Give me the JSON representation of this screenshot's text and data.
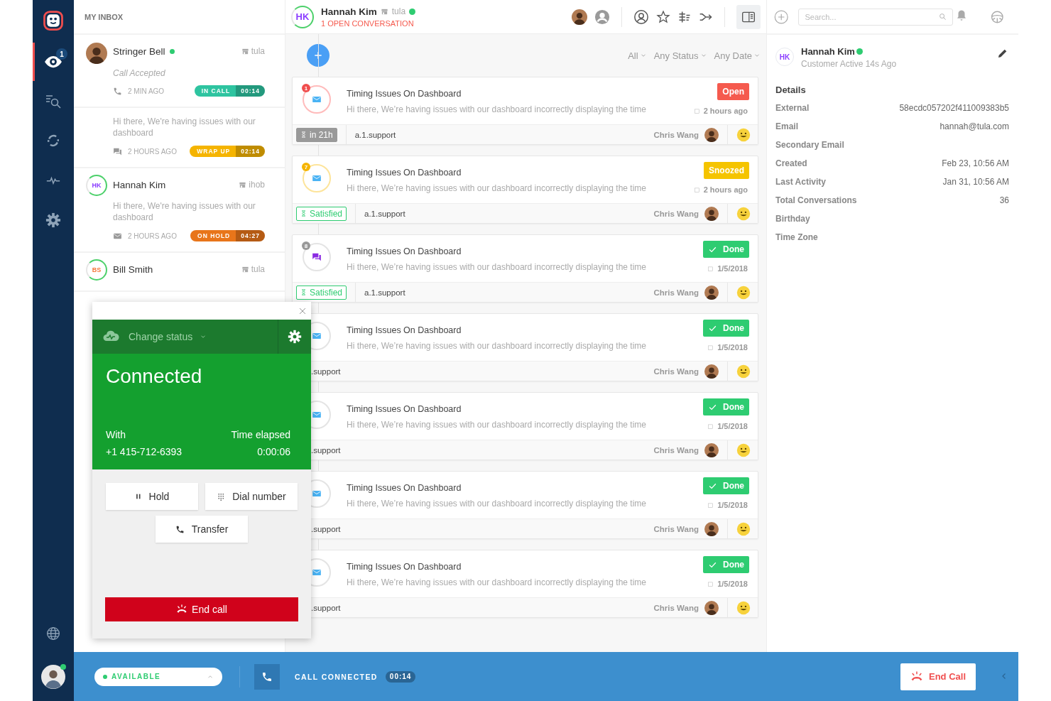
{
  "rail": {
    "items": [
      {
        "kind": "watch",
        "selected": true,
        "badge": "1"
      },
      {
        "kind": "search",
        "selected": false
      },
      {
        "kind": "sync",
        "selected": false
      },
      {
        "kind": "activity",
        "selected": false
      },
      {
        "kind": "settings",
        "selected": false
      }
    ],
    "bottom_items": [
      {
        "kind": "globe",
        "selected": false
      }
    ],
    "agent": {
      "online": true
    }
  },
  "inbox": {
    "title": "MY INBOX",
    "items": [
      {
        "name": "Stringer Bell",
        "avatar": {
          "kind": "photo"
        },
        "online": true,
        "brand": "tula",
        "subtitle": "Call Accepted",
        "kind": "phone",
        "time": "2 MIN AGO",
        "pill": {
          "label": "IN CALL",
          "timer": "00:14",
          "color": "#2ec4a0"
        }
      },
      {
        "preview": "Hi there, We're having issues with our dashboard",
        "kind": "chat",
        "time": "2 HOURS AGO",
        "pill": {
          "label": "WRAP UP",
          "timer": "02:14",
          "color": "#f5b400"
        }
      },
      {
        "name": "Hannah Kim",
        "avatar": {
          "kind": "initials",
          "initials": "HK",
          "color": "#8b3dff"
        },
        "online": false,
        "brand": "ihob",
        "preview": "Hi there, We're having issues with our dashboard",
        "kind": "email",
        "time": "2 HOURS AGO",
        "pill": {
          "label": "ON HOLD",
          "timer": "04:27",
          "color": "#e8751a"
        }
      },
      {
        "name": "Bill Smith",
        "avatar": {
          "kind": "initials",
          "initials": "BS",
          "color": "#f5773a"
        },
        "online": false,
        "brand": "tula"
      }
    ]
  },
  "conversation": {
    "header": {
      "initials": "HK",
      "name": "Hannah Kim",
      "brand": "tula",
      "online": true,
      "subtitle": "1 OPEN CONVERSATION"
    },
    "filters": [
      {
        "label": "All"
      },
      {
        "label": "Any Status"
      },
      {
        "label": "Any Date"
      }
    ],
    "cards": [
      {
        "kind": "email",
        "count": "1",
        "title": "Timing Issues On Dashboard",
        "preview": "Hi there, We’re having issues with our dashboard incorrectly displaying the time",
        "status": {
          "label": "Open",
          "kind": "open"
        },
        "date": "2 hours ago",
        "tag": {
          "label": "in 21h",
          "kind": "sla"
        },
        "queue": "a.1.support",
        "assignee": "Chris Wang"
      },
      {
        "kind": "email",
        "count": "7",
        "title": "Timing Issues On Dashboard",
        "preview": "Hi there, We’re having issues with our dashboard incorrectly displaying the time",
        "status": {
          "label": "Snoozed",
          "kind": "snoozed"
        },
        "date": "2 hours ago",
        "tag": {
          "label": "Satisfied",
          "kind": "satisfied"
        },
        "queue": "a.1.support",
        "assignee": "Chris Wang"
      },
      {
        "kind": "chat",
        "count": "8",
        "title": "Timing Issues On Dashboard",
        "preview": "Hi there, We’re having issues with our dashboard incorrectly displaying the time",
        "status": {
          "label": "Done",
          "kind": "done"
        },
        "date": "1/5/2018",
        "tag": {
          "label": "Satisfied",
          "kind": "satisfied"
        },
        "queue": "a.1.support",
        "assignee": "Chris Wang"
      },
      {
        "kind": "email",
        "title": "Timing Issues On Dashboard",
        "preview": "Hi there, We’re having issues with our dashboard incorrectly displaying the time",
        "status": {
          "label": "Done",
          "kind": "done"
        },
        "date": "1/5/2018",
        "queue": ".support",
        "assignee": "Chris Wang"
      },
      {
        "kind": "email",
        "title": "Timing Issues On Dashboard",
        "preview": "Hi there, We’re having issues with our dashboard incorrectly displaying the time",
        "status": {
          "label": "Done",
          "kind": "done"
        },
        "date": "1/5/2018",
        "queue": ".support",
        "assignee": "Chris Wang"
      },
      {
        "kind": "email",
        "title": "Timing Issues On Dashboard",
        "preview": "Hi there, We’re having issues with our dashboard incorrectly displaying the time",
        "status": {
          "label": "Done",
          "kind": "done"
        },
        "date": "1/5/2018",
        "queue": ".support",
        "assignee": "Chris Wang"
      },
      {
        "kind": "email",
        "title": "Timing Issues On Dashboard",
        "preview": "Hi there, We’re having issues with our dashboard incorrectly displaying the time",
        "status": {
          "label": "Done",
          "kind": "done"
        },
        "date": "1/5/2018",
        "queue": ".support",
        "assignee": "Chris Wang"
      }
    ]
  },
  "customer": {
    "search_placeholder": "Search...",
    "initials": "HK",
    "name": "Hannah Kim",
    "online": true,
    "activity": "Customer Active 14s Ago",
    "details_title": "Details",
    "details": [
      {
        "label": "External",
        "value": "58ecdc057202f411009383b5"
      },
      {
        "label": "Email",
        "value": "hannah@tula.com"
      },
      {
        "label": "Secondary Email"
      },
      {
        "label": "Created",
        "value": "Feb 23, 10:56 AM"
      },
      {
        "label": "Last Activity",
        "value": "Jan 31, 10:56 AM"
      },
      {
        "label": "Total Conversations",
        "value": "36"
      },
      {
        "label": "Birthday"
      },
      {
        "label": "Time Zone"
      }
    ]
  },
  "call_widget": {
    "status_menu": "Change status",
    "state": "Connected",
    "with_label": "With",
    "number": "+1 415-712-6393",
    "elapsed_label": "Time elapsed",
    "elapsed": "0:00:06",
    "buttons": [
      {
        "label": "Hold",
        "kind": "hold"
      },
      {
        "label": "Dial number",
        "kind": "dialpad"
      },
      {
        "label": "Transfer",
        "kind": "transfer"
      }
    ],
    "end_label": "End call"
  },
  "status_bar": {
    "availability": "AVAILABLE",
    "call_status": "CALL CONNECTED",
    "timer": "00:14",
    "end_label": "End Call"
  }
}
